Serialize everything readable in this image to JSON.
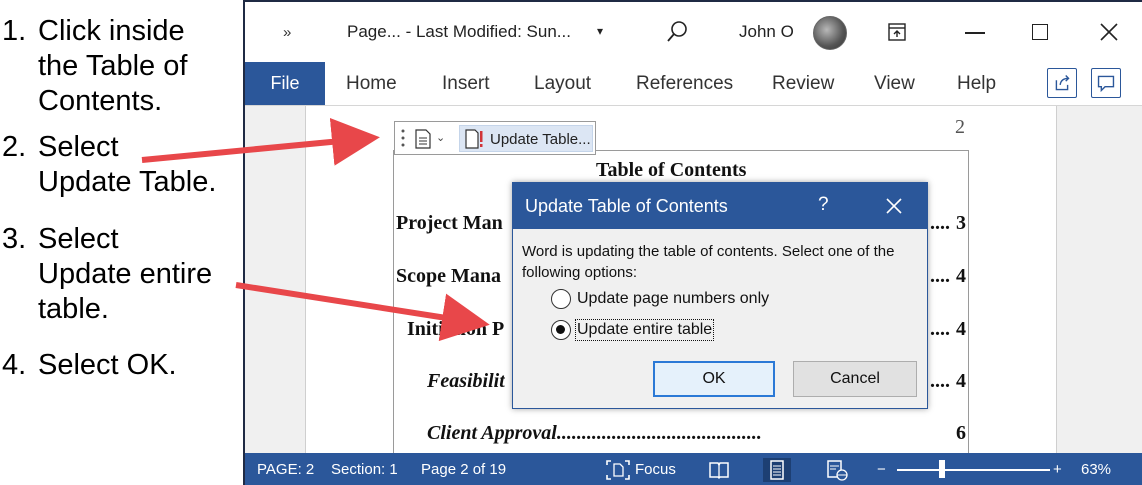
{
  "instructions": [
    {
      "num": "1.",
      "lines": [
        "Click inside",
        "the Table of",
        "Contents."
      ]
    },
    {
      "num": "2.",
      "lines": [
        "Select",
        "Update Table."
      ]
    },
    {
      "num": "3.",
      "lines": [
        "Select",
        "Update entire",
        "table."
      ]
    },
    {
      "num": "4.",
      "lines": [
        "Select OK."
      ]
    }
  ],
  "titlebar": {
    "chevron": "»",
    "doc_title": "Page...  - Last Modified: Sun...",
    "caret": "▾",
    "user_name": "John O"
  },
  "ribbon": {
    "file": "File",
    "tabs": [
      "Home",
      "Insert",
      "Layout",
      "References",
      "Review",
      "View",
      "Help"
    ]
  },
  "document": {
    "page_number": "2",
    "toc_toolbar_label": "Update Table...",
    "toc_title": "Table of Contents",
    "toc_entries": [
      {
        "text": "Project Man",
        "page": "3",
        "italic": false
      },
      {
        "text": "Scope Mana",
        "page": "4",
        "italic": false
      },
      {
        "text": "Initiation P",
        "page": "4",
        "italic": false
      },
      {
        "text": "Feasibilit",
        "page": "4",
        "italic": true
      },
      {
        "text": "Client Approval.........................................",
        "page": "6",
        "italic": true
      }
    ],
    "leader": "...."
  },
  "dialog": {
    "title": "Update Table of Contents",
    "help": "?",
    "message": "Word is updating the table of contents.  Select one of the following options:",
    "options": [
      {
        "label": "Update page numbers only",
        "selected": false
      },
      {
        "label": "Update entire table",
        "selected": true
      }
    ],
    "ok": "OK",
    "cancel": "Cancel"
  },
  "statusbar": {
    "page": "PAGE: 2",
    "section": "Section: 1",
    "page_of": "Page 2 of 19",
    "focus": "Focus",
    "zoom_minus": "−",
    "zoom_plus": "+",
    "zoom": "63%"
  },
  "colors": {
    "word_blue": "#2b579a",
    "arrow_red": "#e8474a"
  }
}
